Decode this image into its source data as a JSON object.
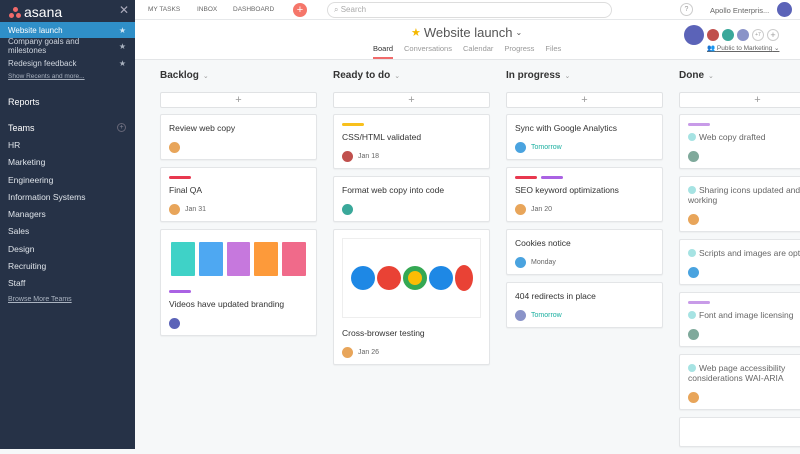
{
  "sidebar": {
    "logo": "asana",
    "favorites": [
      "Website launch",
      "Company goals and milestones",
      "Redesign feedback"
    ],
    "show_recents": "Show Recents and more...",
    "reports": "Reports",
    "teams_label": "Teams",
    "teams": [
      "HR",
      "Marketing",
      "Engineering",
      "Information Systems",
      "Managers",
      "Sales",
      "Design",
      "Recruiting",
      "Staff"
    ],
    "browse": "Browse More Teams"
  },
  "topbar": {
    "nav": [
      "MY TASKS",
      "INBOX",
      "DASHBOARD"
    ],
    "search_placeholder": "Search",
    "help": "?",
    "org": "Apollo Enterpris..."
  },
  "project": {
    "title": "Website launch",
    "tabs": [
      "Board",
      "Conversations",
      "Calendar",
      "Progress",
      "Files"
    ],
    "members_more": "+7",
    "privacy": "Public to Marketing"
  },
  "colors": {
    "accent": "#f06a6a",
    "sidebar": "#263247",
    "active": "#2f8fc8"
  },
  "columns": [
    {
      "title": "Backlog",
      "cards": [
        {
          "title": "Review web copy"
        },
        {
          "title": "Final QA",
          "due": "Jan 31"
        },
        {
          "title": "Videos have updated branding"
        }
      ]
    },
    {
      "title": "Ready to do",
      "cards": [
        {
          "title": "CSS/HTML validated",
          "due": "Jan 18"
        },
        {
          "title": "Format web copy into code"
        },
        {
          "title": "Cross-browser testing",
          "due": "Jan 26"
        }
      ]
    },
    {
      "title": "In progress",
      "cards": [
        {
          "title": "Sync with Google Analytics",
          "due": "Tomorrow"
        },
        {
          "title": "SEO keyword optimizations",
          "due": "Jan 20"
        },
        {
          "title": "Cookies notice",
          "due": "Monday"
        },
        {
          "title": "404 redirects in place",
          "due": "Tomorrow"
        }
      ]
    },
    {
      "title": "Done",
      "cards": [
        {
          "title": "Web copy drafted"
        },
        {
          "title": "Sharing icons updated and working"
        },
        {
          "title": "Scripts and images are optimized"
        },
        {
          "title": "Font and image licensing"
        },
        {
          "title": "Web page accessibility considerations WAI-ARIA"
        }
      ]
    }
  ]
}
